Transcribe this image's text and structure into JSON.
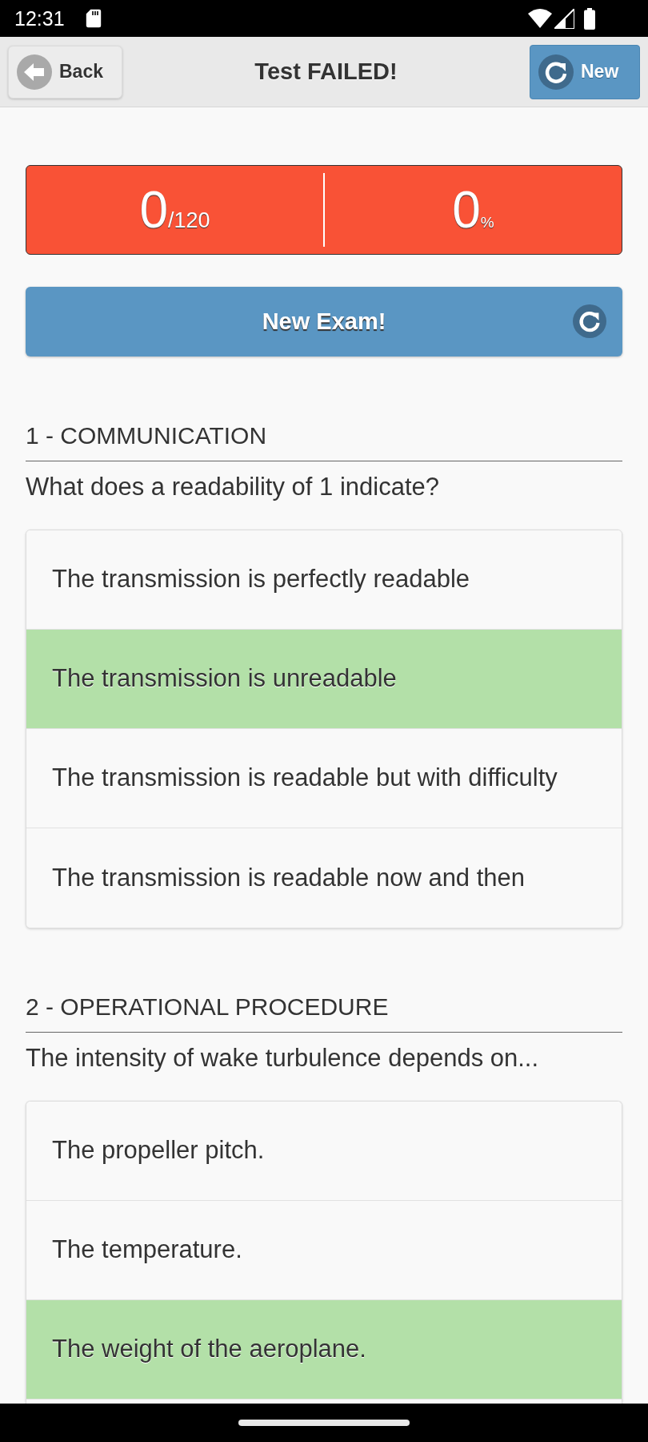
{
  "status_bar": {
    "time": "12:31"
  },
  "header": {
    "back_button": "Back",
    "title": "Test FAILED!",
    "new_button": "New"
  },
  "score": {
    "passed": false,
    "points": "0",
    "points_total": "/120",
    "percent": "0",
    "percent_unit": "%"
  },
  "new_exam_button": "New Exam!",
  "questions": [
    {
      "category": "1 - COMMUNICATION",
      "question": "What does a readability of 1 indicate?",
      "answers": [
        {
          "text": "The transmission is perfectly readable",
          "correct": false
        },
        {
          "text": "The transmission is unreadable",
          "correct": true
        },
        {
          "text": "The transmission is readable but with difficulty",
          "correct": false
        },
        {
          "text": "The transmission is readable now and then",
          "correct": false
        }
      ]
    },
    {
      "category": "2 - OPERATIONAL PROCEDURE",
      "question": "The intensity of wake turbulence depends on...",
      "answers": [
        {
          "text": "The propeller pitch.",
          "correct": false
        },
        {
          "text": "The temperature.",
          "correct": false
        },
        {
          "text": "The weight of the aeroplane.",
          "correct": true
        }
      ]
    }
  ]
}
